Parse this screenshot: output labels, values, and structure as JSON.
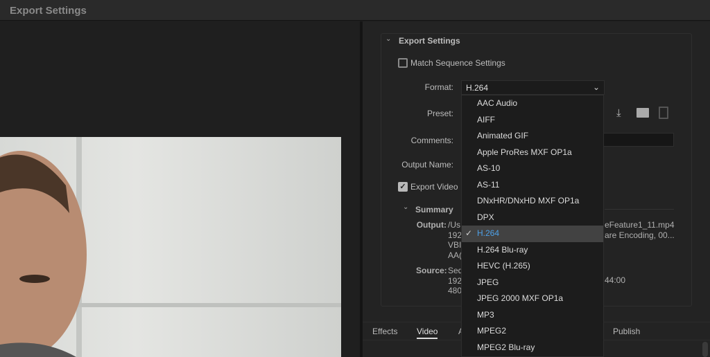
{
  "window": {
    "title": "Export Settings"
  },
  "export_settings": {
    "section_title": "Export Settings",
    "match_sequence_label": "Match Sequence Settings",
    "match_sequence_checked": false,
    "format_label": "Format:",
    "format_value": "H.264",
    "preset_label": "Preset:",
    "comments_label": "Comments:",
    "output_name_label": "Output Name:",
    "export_video_label": "Export Video",
    "export_video_checked": true,
    "summary_title": "Summary",
    "output_label": "Output:",
    "output_lines": [
      "/Us",
      "192",
      "VBI",
      "AA("
    ],
    "output_right": [
      "eFeature1_11.mp4",
      "are Encoding, 00..."
    ],
    "source_label": "Source:",
    "source_lines": [
      "Seq",
      "192",
      "480"
    ],
    "source_right": "44:00"
  },
  "format_options": [
    "AAC Audio",
    "AIFF",
    "Animated GIF",
    "Apple ProRes MXF OP1a",
    "AS-10",
    "AS-11",
    "DNxHR/DNxHD MXF OP1a",
    "DPX",
    "H.264",
    "H.264 Blu-ray",
    "HEVC (H.265)",
    "JPEG",
    "JPEG 2000 MXF OP1a",
    "MP3",
    "MPEG2",
    "MPEG2 Blu-ray"
  ],
  "selected_format": "H.264",
  "tabs": {
    "effects": "Effects",
    "video": "Video",
    "audio_partial": "A",
    "publish": "Publish",
    "active": "Video"
  },
  "colors": {
    "accent": "#4ea0e6"
  }
}
